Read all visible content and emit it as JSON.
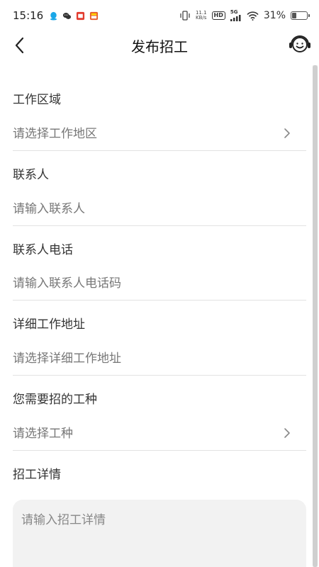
{
  "status_bar": {
    "time": "15:16",
    "speed_value": "11.1",
    "speed_unit": "KB/s",
    "hd": "HD",
    "network": "5G",
    "battery_percent": "31%",
    "battery_level": 0.31
  },
  "header": {
    "title": "发布招工",
    "back_icon": "chevron-left-icon",
    "service_icon": "customer-service-icon"
  },
  "form": {
    "work_area": {
      "label": "工作区域",
      "placeholder": "请选择工作地区"
    },
    "contact": {
      "label": "联系人",
      "placeholder": "请输入联系人"
    },
    "phone": {
      "label": "联系人电话",
      "placeholder": "请输入联系人电话码"
    },
    "address": {
      "label": "详细工作地址",
      "placeholder": "请选择详细工作地址"
    },
    "job_type": {
      "label": "您需要招的工种",
      "placeholder": "请选择工种"
    },
    "details": {
      "label": "招工详情",
      "placeholder": "请输入招工详情"
    }
  },
  "colors": {
    "text_primary": "#333333",
    "text_placeholder": "#777777",
    "divider": "#e2e2e2",
    "textarea_bg": "#f2f2f2"
  }
}
